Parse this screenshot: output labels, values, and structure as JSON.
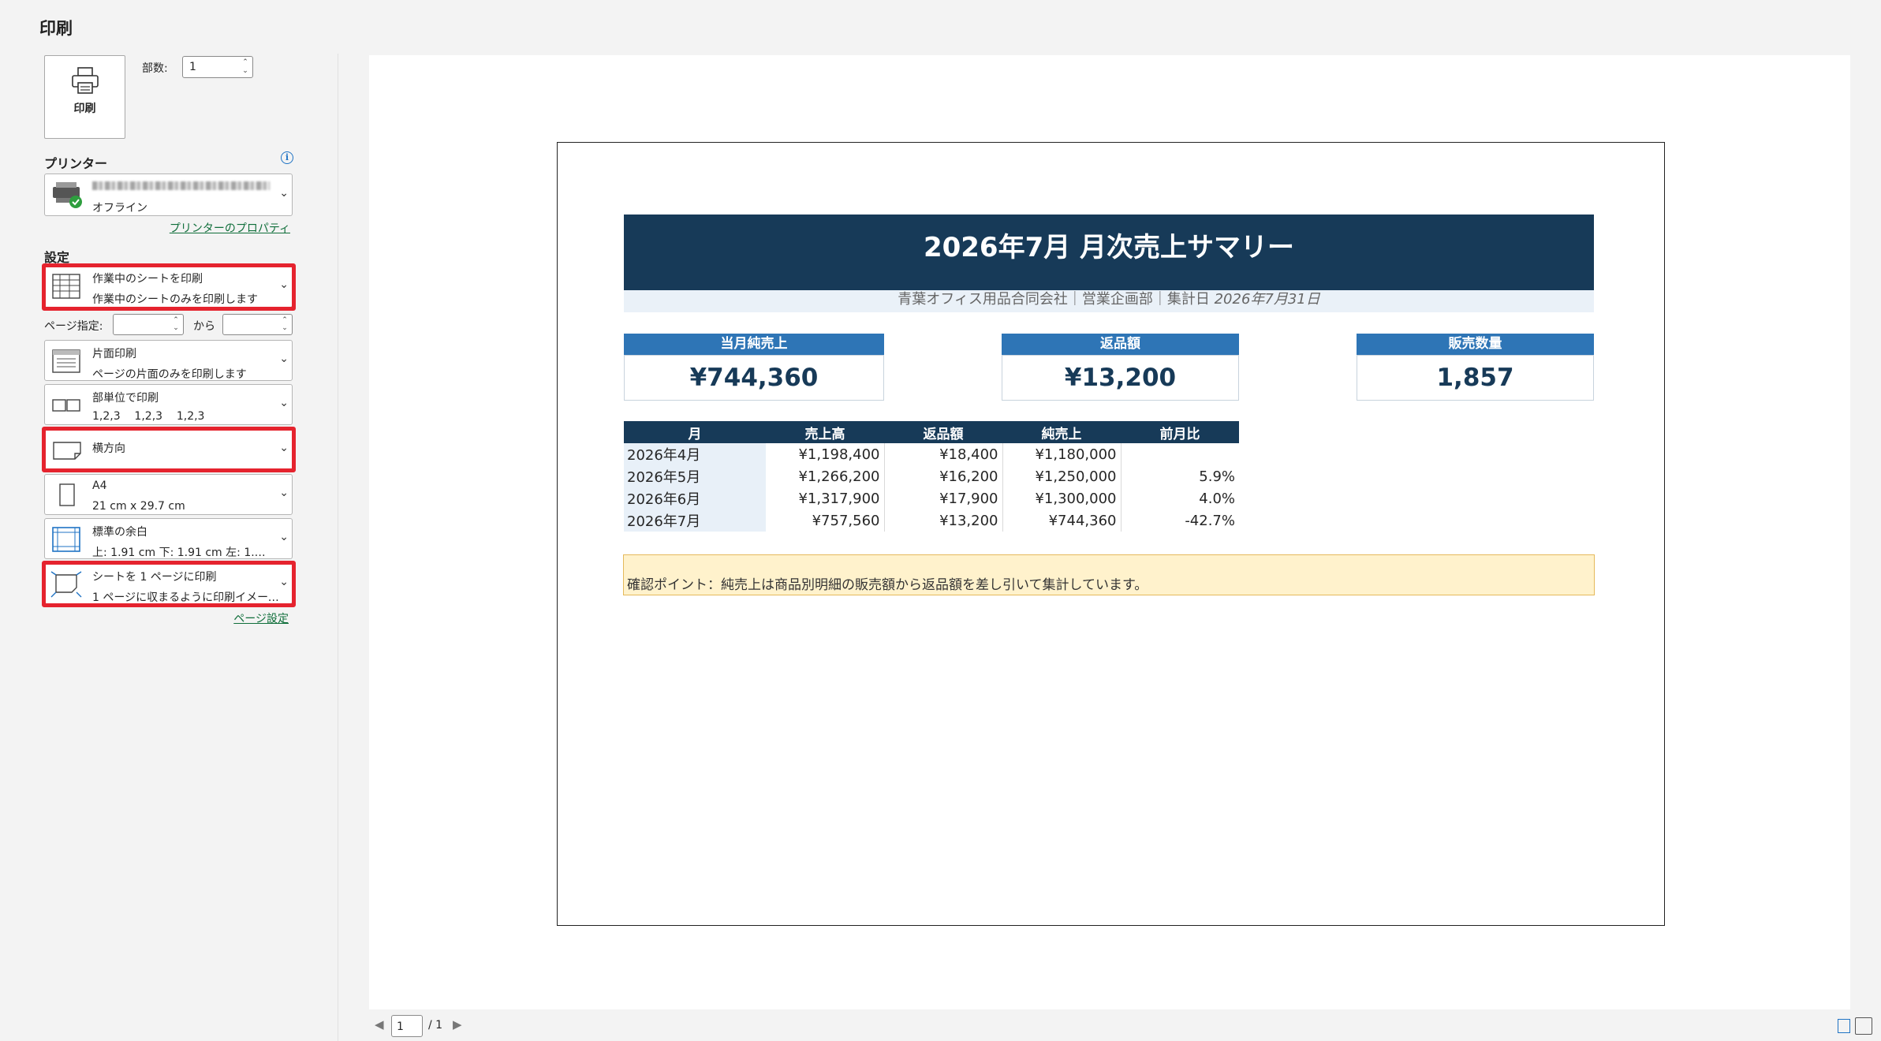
{
  "title": "印刷",
  "print_button_label": "印刷",
  "copies": {
    "label": "部数:",
    "value": "1"
  },
  "printer": {
    "section_label": "プリンター",
    "status": "オフライン",
    "properties_link": "プリンターのプロパティ"
  },
  "settings": {
    "section_label": "設定",
    "scope": {
      "line1": "作業中のシートを印刷",
      "line2": "作業中のシートのみを印刷します"
    },
    "page_range": {
      "label": "ページ指定:",
      "to_label": "から"
    },
    "sides": {
      "line1": "片面印刷",
      "line2": "ページの片面のみを印刷します"
    },
    "collation": {
      "line1": "部単位で印刷",
      "line2": "1,2,3    1,2,3    1,2,3"
    },
    "orientation": {
      "line1": "横方向"
    },
    "paper": {
      "line1": "A4",
      "line2": "21 cm x 29.7 cm"
    },
    "margins": {
      "line1": "標準の余白",
      "line2": "上: 1.91 cm 下: 1.91 cm 左: 1.…"
    },
    "scaling": {
      "line1": "シートを 1 ページに印刷",
      "line2": "1 ページに収まるように印刷イメージを…"
    },
    "page_setup_link": "ページ設定"
  },
  "preview": {
    "banner_title": "2026年7月 月次売上サマリー",
    "subtitle_main": "青葉オフィス用品合同会社｜営業企画部｜集計日 ",
    "subtitle_date": "2026年7月31日",
    "kpis": [
      {
        "label": "当月純売上",
        "value": "¥744,360"
      },
      {
        "label": "返品額",
        "value": "¥13,200"
      },
      {
        "label": "販売数量",
        "value": "1,857"
      }
    ],
    "table": {
      "headers": [
        "月",
        "売上高",
        "返品額",
        "純売上",
        "前月比"
      ],
      "rows": [
        [
          "2026年4月",
          "¥1,198,400",
          "¥18,400",
          "¥1,180,000",
          ""
        ],
        [
          "2026年5月",
          "¥1,266,200",
          "¥16,200",
          "¥1,250,000",
          "5.9%"
        ],
        [
          "2026年6月",
          "¥1,317,900",
          "¥17,900",
          "¥1,300,000",
          "4.0%"
        ],
        [
          "2026年7月",
          "¥757,560",
          "¥13,200",
          "¥744,360",
          "-42.7%"
        ]
      ]
    },
    "note": "確認ポイント：純売上は商品別明細の販売額から返品額を差し引いて集計しています。"
  },
  "pagination": {
    "current": "1",
    "total": "/ 1"
  }
}
